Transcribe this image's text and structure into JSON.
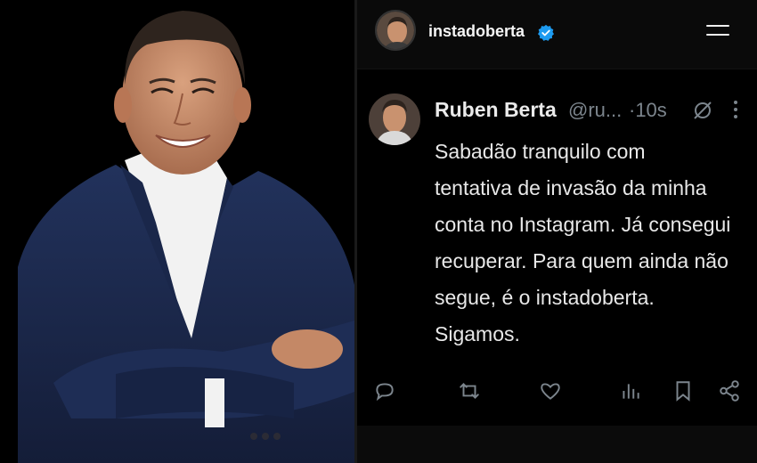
{
  "header": {
    "username": "instadoberta",
    "avatar_icon": "profile-avatar",
    "verified_icon": "verified-badge-icon",
    "menu_icon": "hamburger-menu-icon"
  },
  "tweet": {
    "display_name": "Ruben Berta",
    "handle": "@ru...",
    "time": "·10s",
    "text": "Sabadão tranquilo com\ntentativa de invasão da minha\nconta no Instagram. Já consegui\nrecuperar. Para quem ainda não\nsegue, é o instadoberta.\nSigamos.",
    "actions": [
      "reply-icon",
      "retweet-icon",
      "like-icon",
      "views-icon",
      "bookmark-icon",
      "share-icon"
    ]
  },
  "colors": {
    "background": "#000000",
    "text": "#e7e9ea",
    "muted": "#7c858d",
    "verified": "#1d9bf0",
    "suit": "#1c2a4f"
  }
}
